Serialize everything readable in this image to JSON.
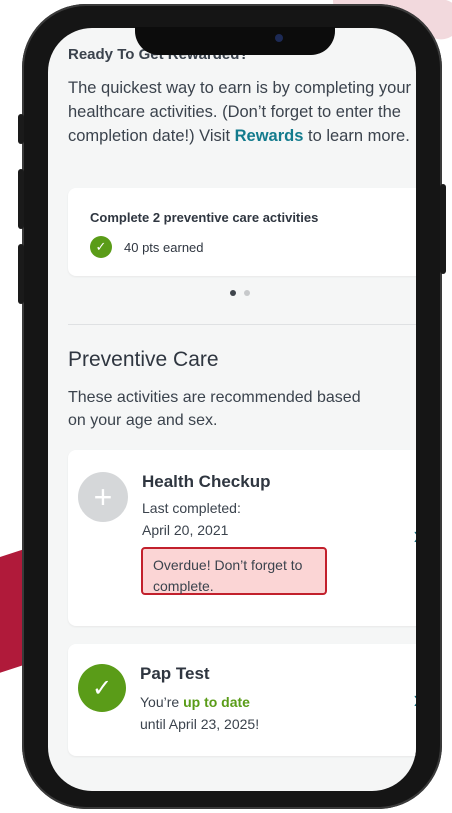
{
  "colors": {
    "accent": "#137b8d",
    "success": "#5a9c18",
    "overdue_bg": "#fbd5d5",
    "overdue_border": "#c2202c"
  },
  "rewards": {
    "title": "Ready To Get Rewarded?",
    "text_before": "The quickest way to earn is by completing your healthcare activities. (Don’t forget to enter the completion date!) Visit ",
    "link": "Rewards",
    "text_after": " to learn more.",
    "card": {
      "title": "Complete 2 preventive care activities",
      "points": "40 pts earned",
      "icon": "check-icon"
    },
    "carousel": {
      "pages": 2,
      "active": 1
    }
  },
  "preventive": {
    "title": "Preventive Care",
    "subtitle": "These activities are recommended based on your age and sex.",
    "activities": [
      {
        "title": "Health Checkup",
        "line1": "Last completed:",
        "line2": "April 20, 2021",
        "alert": "Overdue! Don’t forget to complete.",
        "icon": "plus-icon",
        "chevron": "›"
      },
      {
        "title": "Pap Test",
        "prefix": "You’re ",
        "status": "up to date",
        "line2": "until April 23, 2025!",
        "icon": "check-icon",
        "chevron": "›"
      }
    ]
  }
}
